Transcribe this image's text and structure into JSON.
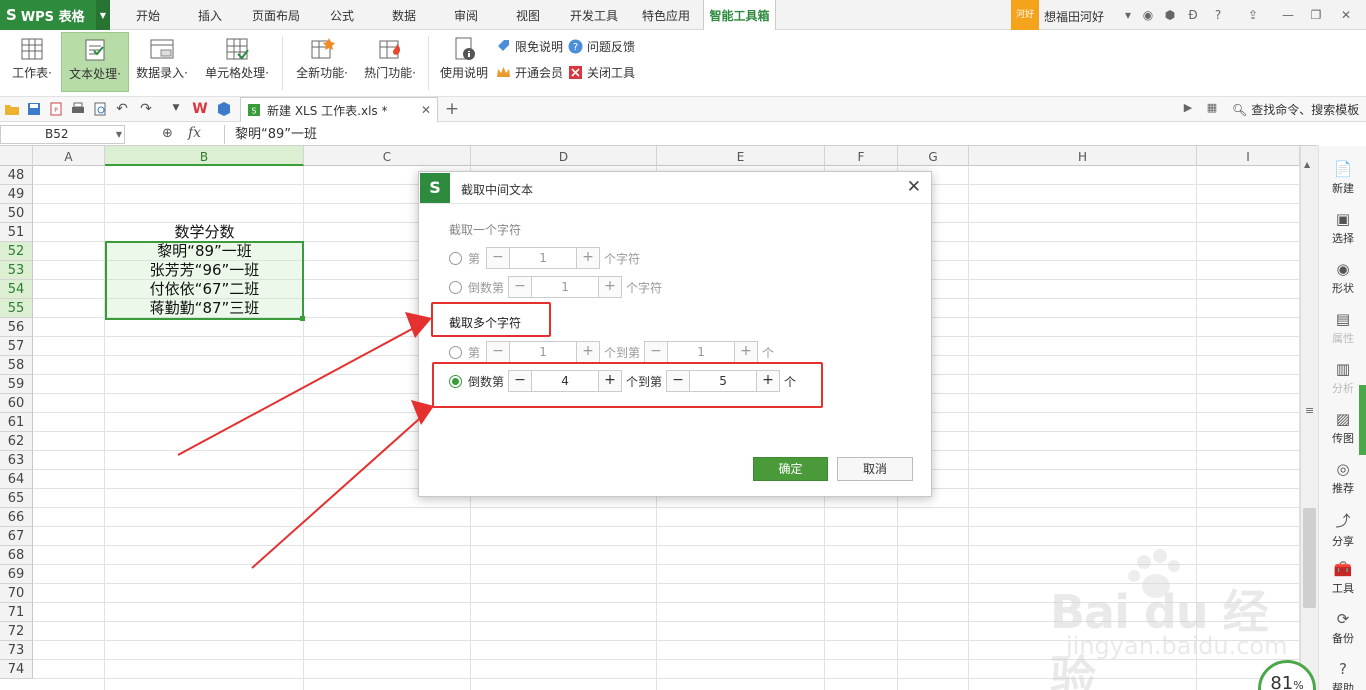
{
  "app": {
    "logo": "WPS 表格",
    "logo_mark": "S"
  },
  "menu_tabs": [
    "开始",
    "插入",
    "页面布局",
    "公式",
    "数据",
    "审阅",
    "视图",
    "开发工具",
    "特色应用",
    "智能工具箱"
  ],
  "user": {
    "badge": "河好",
    "name": "想福田河好"
  },
  "ribbon": {
    "buttons": [
      {
        "label": "工作表·"
      },
      {
        "label": "文本处理·"
      },
      {
        "label": "数据录入·"
      },
      {
        "label": "单元格处理·"
      },
      {
        "label": "全新功能·"
      },
      {
        "label": "热门功能·"
      },
      {
        "label": "使用说明"
      }
    ],
    "small": {
      "free": "限免说明",
      "feedback": "问题反馈",
      "vip": "开通会员",
      "close": "关闭工具"
    }
  },
  "toolbar": {
    "doc_tab": "新建 XLS 工作表.xls *",
    "search": "查找命令、搜索模板"
  },
  "formula_bar": {
    "name_box": "B52",
    "fx": "fx",
    "content": "黎明“89”一班"
  },
  "sheet": {
    "columns": [
      "A",
      "B",
      "C",
      "D",
      "E",
      "F",
      "G",
      "H",
      "I"
    ],
    "rows": [
      "48",
      "49",
      "50",
      "51",
      "52",
      "53",
      "54",
      "55",
      "56",
      "57",
      "58",
      "59",
      "60",
      "61",
      "62",
      "63",
      "64",
      "65",
      "66",
      "67",
      "68",
      "69",
      "70",
      "71",
      "72",
      "73",
      "74"
    ],
    "cells": {
      "B51": "数学分数",
      "B52": "黎明“89”一班",
      "B53": "张芳芳“96”一班",
      "B54": "付依依“67”二班",
      "B55": "蒋勤勤“87”三班"
    }
  },
  "dialog": {
    "title": "截取中间文本",
    "section1": "截取一个字符",
    "row1": {
      "prefix": "第",
      "value": "1",
      "suffix": "个字符"
    },
    "row2": {
      "prefix": "倒数第",
      "value": "1",
      "suffix": "个字符"
    },
    "section2": "截取多个字符",
    "row3": {
      "prefix": "第",
      "from": "1",
      "mid": "个到第",
      "to": "1",
      "suffix": "个"
    },
    "row4": {
      "prefix": "倒数第",
      "from": "4",
      "mid": "个到第",
      "to": "5",
      "suffix": "个"
    },
    "ok": "确定",
    "cancel": "取消"
  },
  "sidebar": [
    "新建",
    "选择",
    "形状",
    "属性",
    "分析",
    "传图",
    "推荐",
    "分享",
    "工具",
    "备份",
    "帮助"
  ],
  "zoom": "81",
  "watermark": {
    "main": "Bai du 经验",
    "sub": "jingyan.baidu.com"
  },
  "colors": {
    "brand": "#2e8b3d",
    "annotation": "#e53030",
    "selection": "#3a9b3a"
  }
}
